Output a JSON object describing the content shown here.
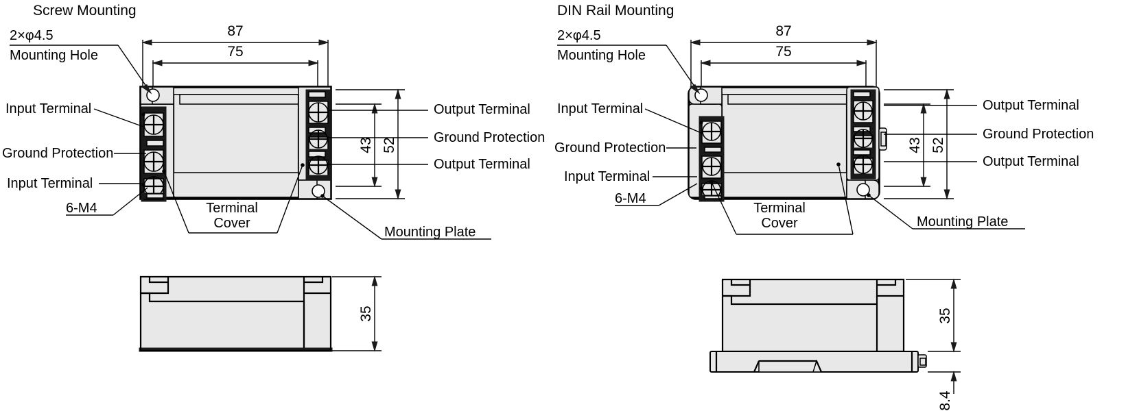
{
  "drawing": {
    "type": "engineering-dimension-drawing",
    "units": "mm",
    "line_color": "#000000",
    "body_fill": "#e8e8e8",
    "background": "#ffffff"
  },
  "views": {
    "screw": {
      "title": "Screw Mounting",
      "labels": {
        "mounting_hole_spec": "2×φ4.5",
        "mounting_hole_text": "Mounting Hole",
        "input_terminal_top": "Input Terminal",
        "ground_protection_left": "Ground Protection",
        "input_terminal_bottom": "Input Terminal",
        "screw_spec": "6-M4",
        "terminal_cover_line1": "Terminal",
        "terminal_cover_line2": "Cover",
        "mounting_plate": "Mounting Plate",
        "output_terminal_top": "Output Terminal",
        "ground_protection_right": "Ground Protection",
        "output_terminal_bottom": "Output Terminal"
      },
      "dimensions": {
        "overall_width": "87",
        "hole_pitch_width": "75",
        "hole_pitch_height": "43",
        "overall_height": "52",
        "side_height": "35"
      }
    },
    "din": {
      "title": "DIN Rail Mounting",
      "labels": {
        "mounting_hole_spec": "2×φ4.5",
        "mounting_hole_text": "Mounting Hole",
        "input_terminal_top": "Input Terminal",
        "ground_protection_left": "Ground Protection",
        "input_terminal_bottom": "Input Terminal",
        "screw_spec": "6-M4",
        "terminal_cover_line1": "Terminal",
        "terminal_cover_line2": "Cover",
        "mounting_plate": "Mounting Plate",
        "output_terminal_top": "Output Terminal",
        "ground_protection_right": "Ground Protection",
        "output_terminal_bottom": "Output Terminal"
      },
      "dimensions": {
        "overall_width": "87",
        "hole_pitch_width": "75",
        "hole_pitch_height": "43",
        "overall_height": "52",
        "side_height": "35",
        "din_clip_height": "8.4"
      }
    }
  }
}
